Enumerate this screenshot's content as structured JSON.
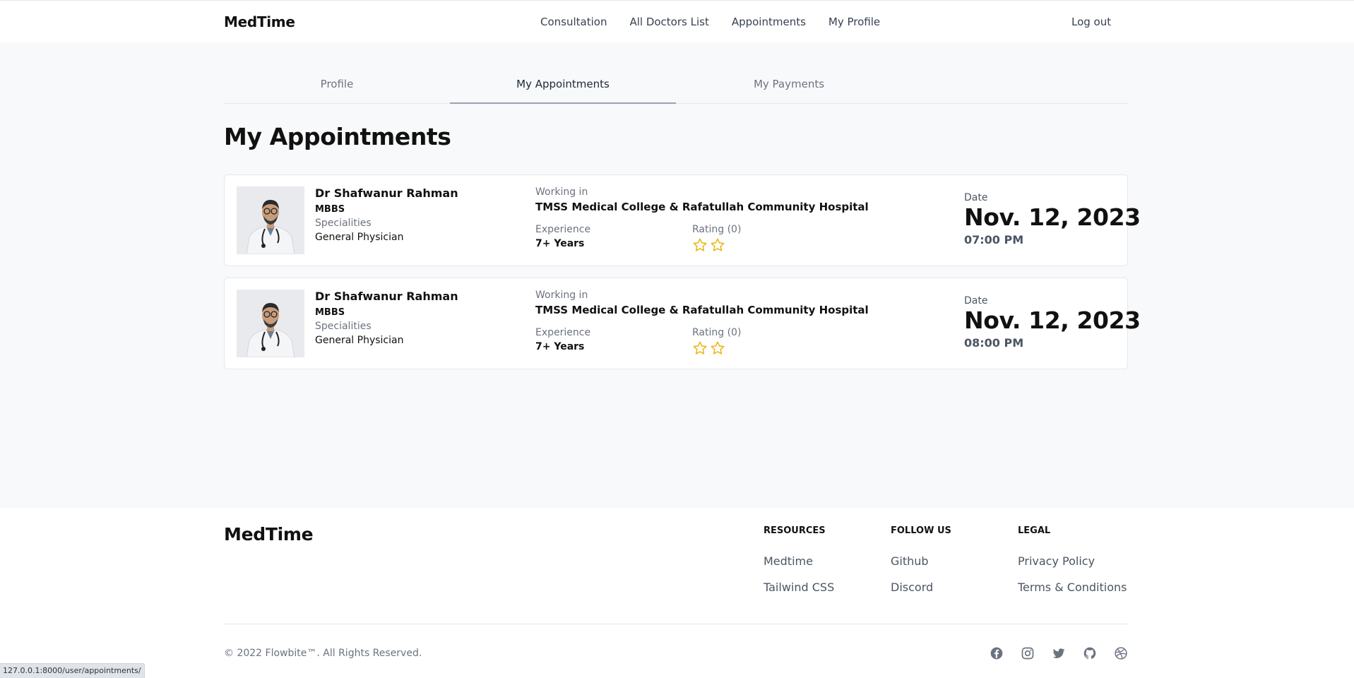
{
  "nav": {
    "brand": "MedTime",
    "links": [
      "Consultation",
      "All Doctors List",
      "Appointments",
      "My Profile"
    ],
    "logout": "Log out"
  },
  "tabs": [
    {
      "label": "Profile",
      "active": false
    },
    {
      "label": "My Appointments",
      "active": true
    },
    {
      "label": "My Payments",
      "active": false
    }
  ],
  "page_title": "My Appointments",
  "labels": {
    "working_in": "Working in",
    "specialities": "Specialities",
    "experience": "Experience",
    "date": "Date"
  },
  "appointments": [
    {
      "doctor_name": "Dr Shafwanur Rahman",
      "degree": "MBBS",
      "speciality": "General Physician",
      "hospital": "TMSS Medical College & Rafatullah Community Hospital",
      "experience": "7+ Years",
      "rating_text": "Rating (0)",
      "stars": 2,
      "date": "Nov. 12, 2023",
      "time": "07:00 PM"
    },
    {
      "doctor_name": "Dr Shafwanur Rahman",
      "degree": "MBBS",
      "speciality": "General Physician",
      "hospital": "TMSS Medical College & Rafatullah Community Hospital",
      "experience": "7+ Years",
      "rating_text": "Rating (0)",
      "stars": 2,
      "date": "Nov. 12, 2023",
      "time": "08:00 PM"
    }
  ],
  "footer": {
    "brand": "MedTime",
    "columns": [
      {
        "heading": "Resources",
        "links": [
          "Medtime",
          "Tailwind CSS"
        ]
      },
      {
        "heading": "Follow us",
        "links": [
          "Github",
          "Discord"
        ]
      },
      {
        "heading": "Legal",
        "links": [
          "Privacy Policy",
          "Terms & Conditions"
        ]
      }
    ],
    "copyright": "© 2022 Flowbite™. All Rights Reserved.",
    "social_icons": [
      "facebook-icon",
      "instagram-icon",
      "twitter-icon",
      "github-icon",
      "dribbble-icon"
    ]
  },
  "status_url": "127.0.0.1:8000/user/appointments/",
  "colors": {
    "star": "#eab308",
    "text_muted": "#6b7280",
    "border": "#e5e7eb"
  }
}
